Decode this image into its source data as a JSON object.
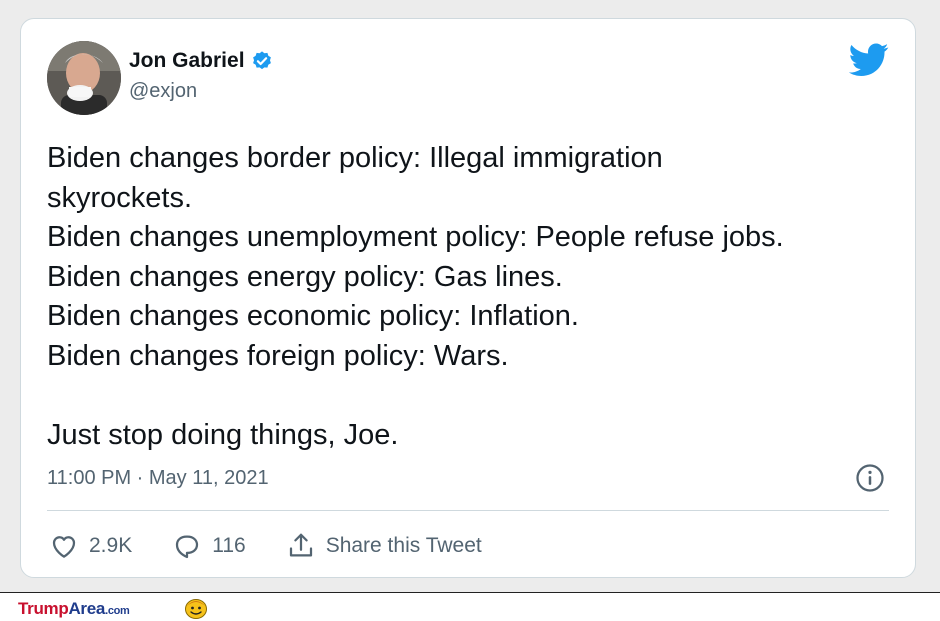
{
  "tweet": {
    "author": {
      "name": "Jon Gabriel",
      "handle": "@exjon",
      "verified": true
    },
    "text_lines": [
      "Biden changes border policy: Illegal immigration",
      "skyrockets.",
      "Biden changes unemployment policy: People refuse jobs.",
      "Biden changes energy policy: Gas lines.",
      "Biden changes economic policy: Inflation.",
      "Biden changes foreign policy: Wars.",
      "",
      "Just stop doing things, Joe."
    ],
    "timestamp": "11:00 PM · May 11, 2021",
    "actions": {
      "likes": "2.9K",
      "replies": "116",
      "share_label": "Share this Tweet"
    }
  },
  "footer": {
    "brand_trump": "Trump",
    "brand_area": "Area",
    "brand_com": ".com"
  },
  "colors": {
    "twitter_blue": "#1d9bf0",
    "text_primary": "#0f1419",
    "text_secondary": "#536471",
    "border": "#cfd9de",
    "brand_red": "#c8102e",
    "brand_blue": "#1f3c8c"
  },
  "icons": [
    "avatar-photo",
    "verified-badge-icon",
    "twitter-bird-icon",
    "info-icon",
    "heart-icon",
    "reply-icon",
    "share-icon",
    "smiley-logo-icon"
  ]
}
